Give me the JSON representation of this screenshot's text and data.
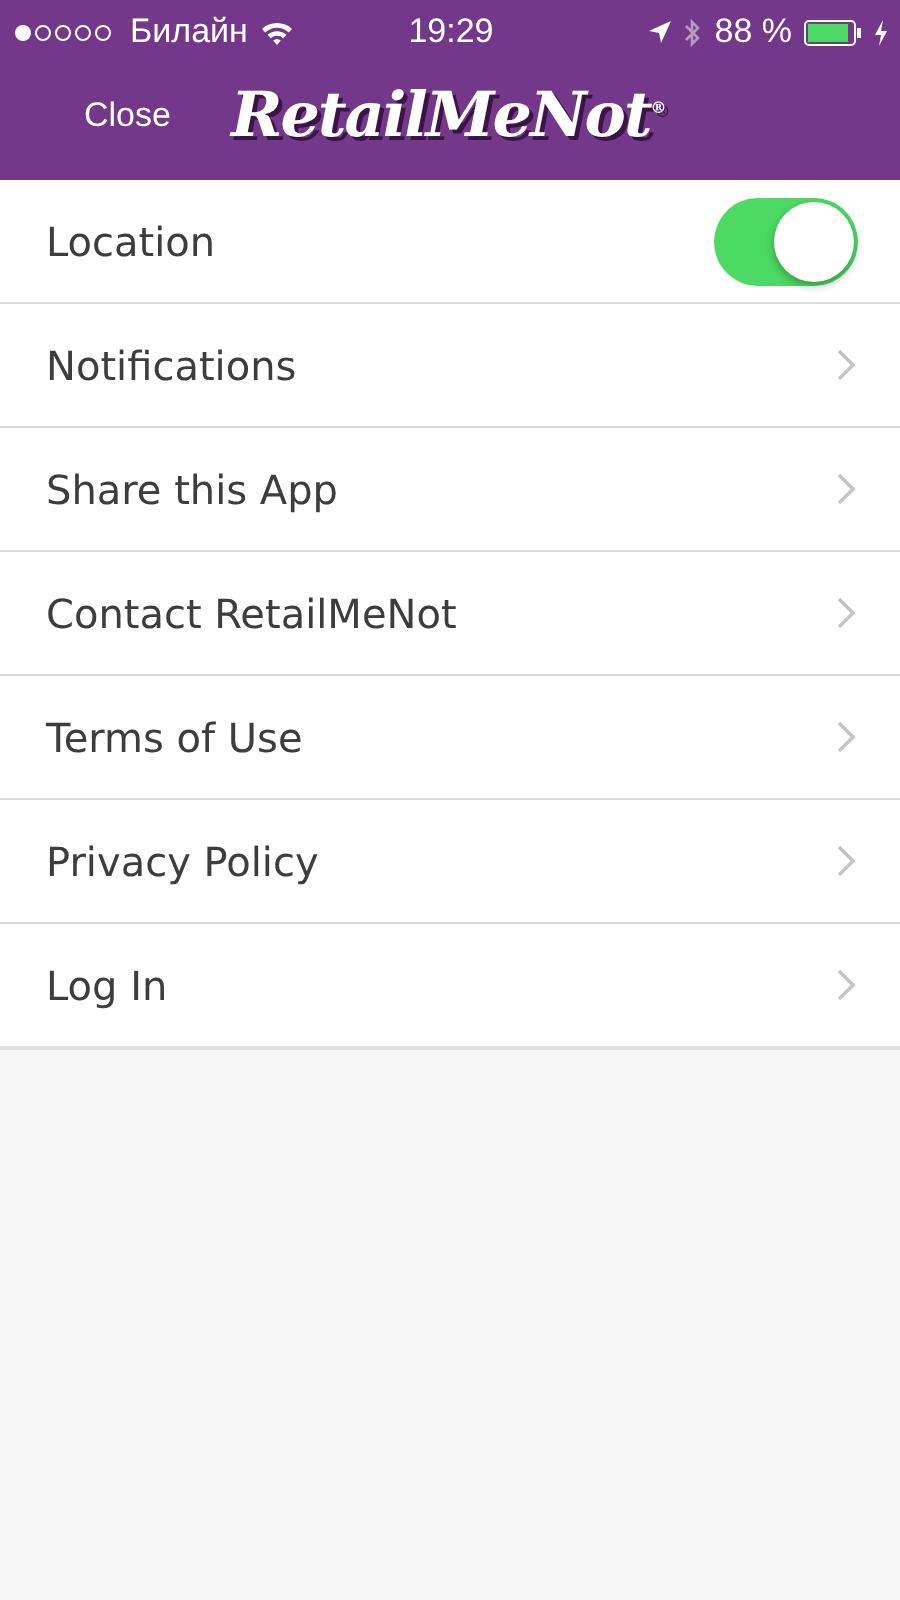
{
  "status_bar": {
    "carrier": "Билайн",
    "time": "19:29",
    "battery_percent": "88 %"
  },
  "header": {
    "close": "Close",
    "logo": "RetailMeNot$^{®}$"
  },
  "items": [
    {
      "label": "Location",
      "kind": "toggle",
      "on": true
    },
    {
      "label": "Notifications",
      "kind": "link"
    },
    {
      "label": "Share this App",
      "kind": "link"
    },
    {
      "label": "Contact RetailMeNot",
      "kind": "link"
    },
    {
      "label": "Terms of Use",
      "kind": "link"
    },
    {
      "label": "Privacy Policy",
      "kind": "link"
    },
    {
      "label": "Log In",
      "kind": "link"
    }
  ]
}
